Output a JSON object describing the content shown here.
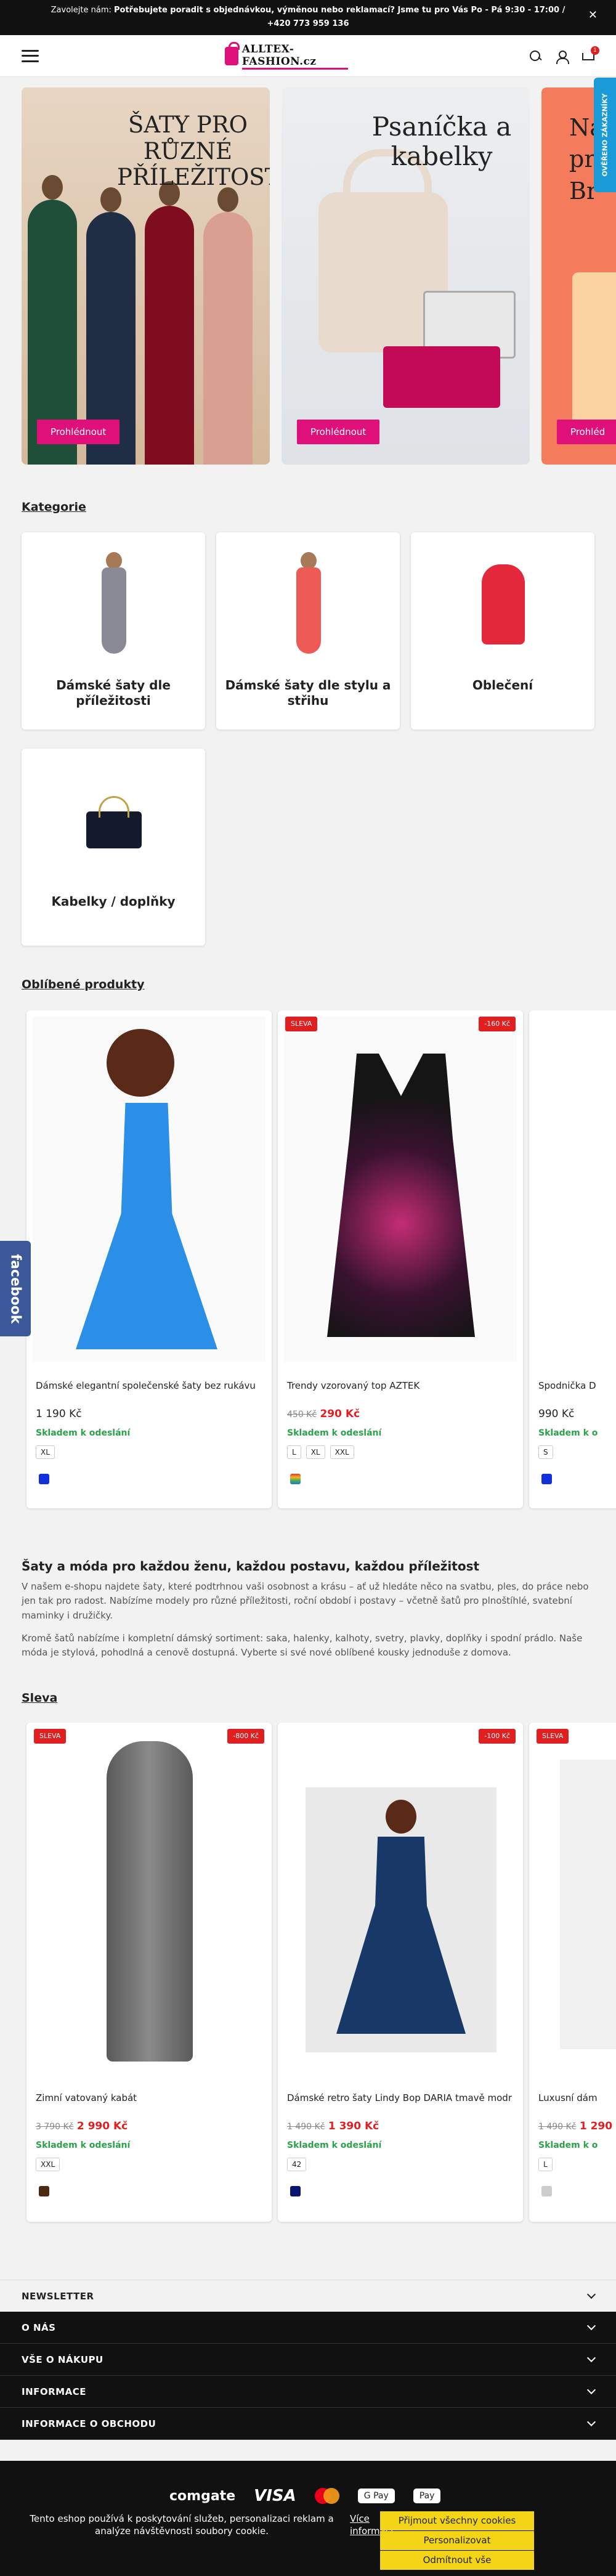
{
  "topbar": {
    "prefix": "Zavolejte nám: ",
    "bold": "Potřebujete poradit s objednávkou, výměnou nebo reklamací? Jsme tu pro Vás Po - Pá 9:30 - 17:00 / +420 773 959 136"
  },
  "header": {
    "logo_text": "ALLTEX-FASHION.cz",
    "cart_count": "1"
  },
  "side_badge": "OVĚŘENO ZÁKAZNÍKY",
  "facebook_tab": "facebook",
  "banners": [
    {
      "title": "ŠATY PRO RŮZNÉ PŘÍLEŽITOSTI",
      "button": "Prohlédnout"
    },
    {
      "title": "Psaníčka a kabelky",
      "button": "Prohlédnout"
    },
    {
      "title": "Na\npr\nBr",
      "button": "Prohléd"
    }
  ],
  "categories": {
    "title": "Kategorie",
    "items": [
      {
        "name": "Dámské šaty dle příležitosti"
      },
      {
        "name": "Dámské šaty dle stylu a střihu"
      },
      {
        "name": "Oblečení"
      },
      {
        "name": "Kabelky / doplňky"
      }
    ]
  },
  "popular": {
    "title": "Oblíbené produkty",
    "products": [
      {
        "name": "Dámské elegantní společenské šaty bez rukávu",
        "price": "1 190 Kč",
        "old_price": "",
        "tag_left": "",
        "tag_right": "",
        "stock": "Skladem k odeslání",
        "sizes": [
          "XL"
        ],
        "swatch": "#1430d8"
      },
      {
        "name": "Trendy vzorovaný top AZTEK",
        "price": "290 Kč",
        "old_price": "450 Kč",
        "tag_left": "SLEVA",
        "tag_right": "-160 Kč",
        "stock": "Skladem k odeslání",
        "sizes": [
          "L",
          "XL",
          "XXL"
        ],
        "swatch": "#e87a2a"
      },
      {
        "name": "Spodnička D",
        "price": "990 Kč",
        "old_price": "",
        "tag_left": "",
        "tag_right": "",
        "stock": "Skladem k o",
        "sizes": [
          "S"
        ],
        "swatch": "#1430d8"
      }
    ]
  },
  "about": {
    "title": "Šaty a móda pro každou ženu, každou postavu, každou příležitost",
    "p1": "V našem e-shopu najdete šaty, které podtrhnou vaši osobnost a krásu – ať už hledáte něco na svatbu, ples, do práce nebo jen tak pro radost. Nabízíme modely pro různé příležitosti, roční období i postavy – včetně šatů pro plnoštíhlé, svatební maminky i družičky.",
    "p2": "Kromě šatů nabízíme i kompletní dámský sortiment: saka, halenky, kalhoty, svetry, plavky, doplňky i spodní prádlo. Naše móda je stylová, pohodlná a cenově dostupná. Vyberte si své nové oblíbené kousky jednoduše z domova."
  },
  "sale": {
    "title": "Sleva",
    "products": [
      {
        "name": "Zimní vatovaný kabát",
        "price": "2 990 Kč",
        "old_price": "3 790 Kč",
        "tag_left": "SLEVA",
        "tag_right": "-800 Kč",
        "stock": "Skladem k odeslání",
        "sizes": [
          "XXL"
        ],
        "swatch": "#4a2a12"
      },
      {
        "name": "Dámské retro šaty Lindy Bop DARIA tmavě modr",
        "price": "1 390 Kč",
        "old_price": "1 490 Kč",
        "tag_left": "",
        "tag_right": "-100 Kč",
        "stock": "Skladem k odeslání",
        "sizes": [
          "42"
        ],
        "swatch": "#0a1470"
      },
      {
        "name": "Luxusní dám",
        "price": "1 290",
        "old_price": "1 490 Kč",
        "tag_left": "SLEVA",
        "tag_right": "",
        "stock": "Skladem k o",
        "sizes": [
          "L"
        ],
        "swatch": "#cccccc"
      }
    ]
  },
  "footer": {
    "newsletter": "NEWSLETTER",
    "sections": [
      "O NÁS",
      "VŠE O NÁKUPU",
      "INFORMACE",
      "INFORMACE O OBCHODU"
    ],
    "payments": {
      "comgate": "comgate",
      "visa": "VISA",
      "gpay": "G Pay",
      "apay": " Pay"
    }
  },
  "cookie": {
    "text": "Tento eshop používá k poskytování služeb, personalizaci reklam a analýze návštěvnosti soubory cookie.",
    "more": "Více informací",
    "accept": "Přijmout všechny cookies",
    "personalize": "Personalizovat",
    "reject": "Odmítnout vše"
  }
}
